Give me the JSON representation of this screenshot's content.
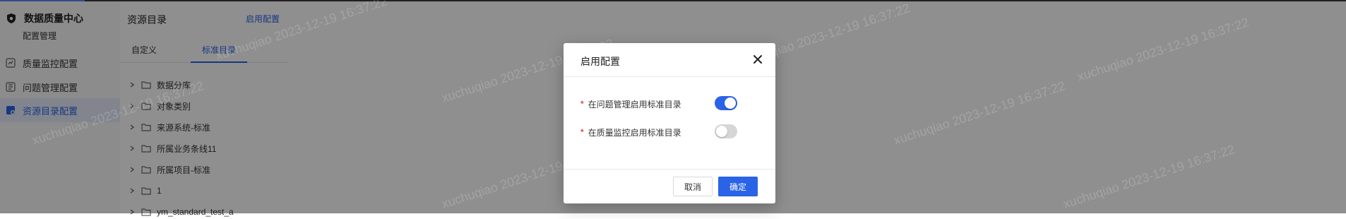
{
  "colors": {
    "accent": "#2b63e6",
    "required": "#e34b4b",
    "overlay": "rgba(0,0,0,0.44)"
  },
  "sidebar": {
    "title": "数据质量中心",
    "subtitle": "配置管理",
    "items": [
      {
        "label": "质量监控配置",
        "icon": "quality-monitor-icon",
        "active": false
      },
      {
        "label": "问题管理配置",
        "icon": "issue-manage-icon",
        "active": false
      },
      {
        "label": "资源目录配置",
        "icon": "resource-catalog-icon",
        "active": true
      }
    ]
  },
  "directory": {
    "title": "资源目录",
    "enable_link": "启用配置",
    "tabs": [
      {
        "label": "自定义",
        "active": false
      },
      {
        "label": "标准目录",
        "active": true
      }
    ],
    "tree": [
      "数据分库",
      "对象类别",
      "来源系统-标准",
      "所属业务条线11",
      "所属项目-标准",
      "1",
      "ym_standard_test_a"
    ]
  },
  "watermark": "xuchuqiao 2023-12-19 16:37:22",
  "modal": {
    "title": "启用配置",
    "rows": [
      {
        "label": "在问题管理启用标准目录",
        "required": true,
        "enabled": true
      },
      {
        "label": "在质量监控启用标准目录",
        "required": true,
        "enabled": false
      }
    ],
    "cancel_label": "取消",
    "ok_label": "确定"
  }
}
